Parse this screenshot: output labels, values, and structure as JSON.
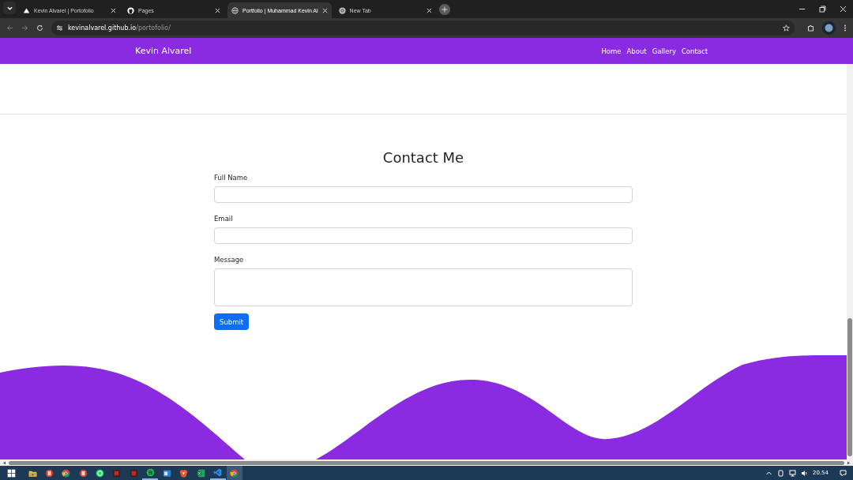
{
  "browser": {
    "tabs": [
      {
        "title": "Kevin Alvarel | Portofolio",
        "kind": "triangle",
        "selected": false
      },
      {
        "title": "Pages",
        "kind": "github",
        "selected": false
      },
      {
        "title": "Portfolio | Muhammad Kevin Al",
        "kind": "globe",
        "selected": true
      },
      {
        "title": "New Tab",
        "kind": "chrome",
        "selected": false
      }
    ],
    "url": {
      "host": "kevinalvarel.github.io",
      "path": "/portofolio/"
    }
  },
  "navbar": {
    "brand": "Kevin Alvarel",
    "links": [
      "Home",
      "About",
      "Gallery",
      "Contact"
    ]
  },
  "contact": {
    "title": "Contact Me",
    "fields": [
      {
        "label": "Full Name",
        "kind": "input"
      },
      {
        "label": "Email",
        "kind": "input"
      },
      {
        "label": "Message",
        "kind": "textarea"
      }
    ],
    "submit": "Submit"
  },
  "taskbar": {
    "apps": [
      {
        "kind": "folder",
        "running": false,
        "selected": false
      },
      {
        "kind": "red",
        "running": false,
        "selected": false
      },
      {
        "kind": "chrome",
        "running": false,
        "selected": false
      },
      {
        "kind": "red",
        "running": false,
        "selected": false
      },
      {
        "kind": "whatsapp",
        "running": false,
        "selected": false
      },
      {
        "kind": "dark",
        "running": false,
        "selected": false
      },
      {
        "kind": "dark",
        "running": false,
        "selected": false
      },
      {
        "kind": "spotify",
        "running": true,
        "selected": false
      },
      {
        "kind": "blue",
        "running": false,
        "selected": false
      },
      {
        "kind": "brave",
        "running": false,
        "selected": false
      },
      {
        "kind": "excel",
        "running": false,
        "selected": false
      },
      {
        "kind": "vscode",
        "running": true,
        "selected": false
      },
      {
        "kind": "chrome",
        "running": false,
        "selected": true
      }
    ],
    "clock": "20.54"
  }
}
